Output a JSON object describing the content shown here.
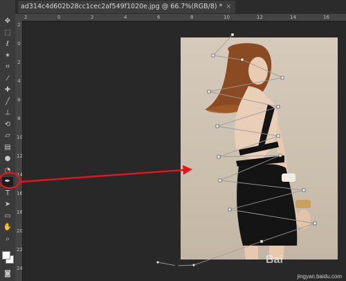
{
  "document_tab": {
    "title": "ad314c4d602b28cc1cec2af549f1020e.jpg @ 66.7%(RGB/8) *",
    "close_glyph": "×"
  },
  "ruler_h": [
    "2",
    "0",
    "2",
    "4",
    "6",
    "8",
    "10",
    "12",
    "14",
    "16"
  ],
  "ruler_v": [
    "2",
    "0",
    "2",
    "4",
    "6",
    "8",
    "10",
    "12",
    "14",
    "16",
    "18",
    "20",
    "22",
    "24"
  ],
  "tools": [
    {
      "name": "move-tool-icon",
      "glyph": "✥"
    },
    {
      "name": "marquee-tool-icon",
      "glyph": "⬚"
    },
    {
      "name": "lasso-tool-icon",
      "glyph": "ℓ"
    },
    {
      "name": "magic-wand-tool-icon",
      "glyph": "✶"
    },
    {
      "name": "crop-tool-icon",
      "glyph": "⌗"
    },
    {
      "name": "eyedropper-tool-icon",
      "glyph": "⁄"
    },
    {
      "name": "healing-brush-tool-icon",
      "glyph": "✚"
    },
    {
      "name": "brush-tool-icon",
      "glyph": "╱"
    },
    {
      "name": "clone-stamp-tool-icon",
      "glyph": "⊥"
    },
    {
      "name": "history-brush-tool-icon",
      "glyph": "⟲"
    },
    {
      "name": "eraser-tool-icon",
      "glyph": "▱"
    },
    {
      "name": "gradient-tool-icon",
      "glyph": "▤"
    },
    {
      "name": "blur-tool-icon",
      "glyph": "●"
    },
    {
      "name": "dodge-tool-icon",
      "glyph": "◔"
    },
    {
      "name": "pen-tool-icon",
      "glyph": "✒",
      "active": true
    },
    {
      "name": "type-tool-icon",
      "glyph": "T"
    },
    {
      "name": "path-selection-tool-icon",
      "glyph": "➤"
    },
    {
      "name": "rectangle-tool-icon",
      "glyph": "▭"
    },
    {
      "name": "hand-tool-icon",
      "glyph": "✋"
    },
    {
      "name": "zoom-tool-icon",
      "glyph": "⌕"
    }
  ],
  "colors": {
    "foreground": "#ffffff",
    "background": "#ffffff",
    "annotation": "#e8141c",
    "path_stroke": "#9a9a9a"
  },
  "watermark": {
    "brand": "Bai",
    "url": "jingyan.baidu.com"
  }
}
